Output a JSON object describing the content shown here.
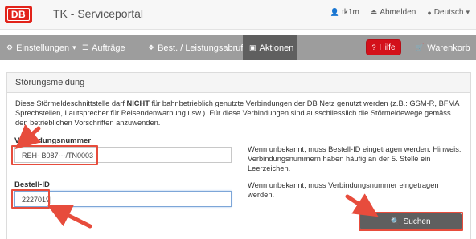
{
  "header": {
    "logo_text": "DB",
    "title": "TK - Serviceportal",
    "user": "tk1m",
    "logout": "Abmelden",
    "language": "Deutsch"
  },
  "nav": {
    "einstellungen": "Einstellungen",
    "auftraege": "Aufträge",
    "best": "Best. / Leistungsabruf",
    "aktionen": "Aktionen",
    "hilfe": "Hilfe",
    "warenkorb": "Warenkorb"
  },
  "panel": {
    "title": "Störungsmeldung",
    "info_part1": "Diese Störmeldeschnittstelle darf ",
    "info_bold": "NICHT",
    "info_part2": " für bahnbetrieblich genutzte Verbindungen der DB Netz genutzt werden (z.B.: GSM-R, BFMA Sprechstellen, Lautsprecher für Reisendenwarnung usw.). Für diese Verbindungen sind ausschliesslich die Störmeldewege gemäss den betrieblichen Vorschriften anzuwenden."
  },
  "form": {
    "verbindungsnummer_label": "Verbindungsnummer",
    "verbindungsnummer_value": "REH- B087---/TN0003",
    "verbindungsnummer_hint": "Wenn unbekannt, muss Bestell-ID eingetragen werden. Hinweis: Verbindungsnummern haben häufig an der 5. Stelle ein Leerzeichen.",
    "bestell_label": "Bestell-ID",
    "bestell_value": "2227019|",
    "bestell_hint": "Wenn unbekannt, muss Verbindungsnummer eingetragen werden.",
    "search_button": "Suchen"
  },
  "colors": {
    "db_red": "#e2231a",
    "nav_bg": "#9d9d9d",
    "nav_active": "#5f5f5f",
    "highlight": "#e74c3c"
  }
}
